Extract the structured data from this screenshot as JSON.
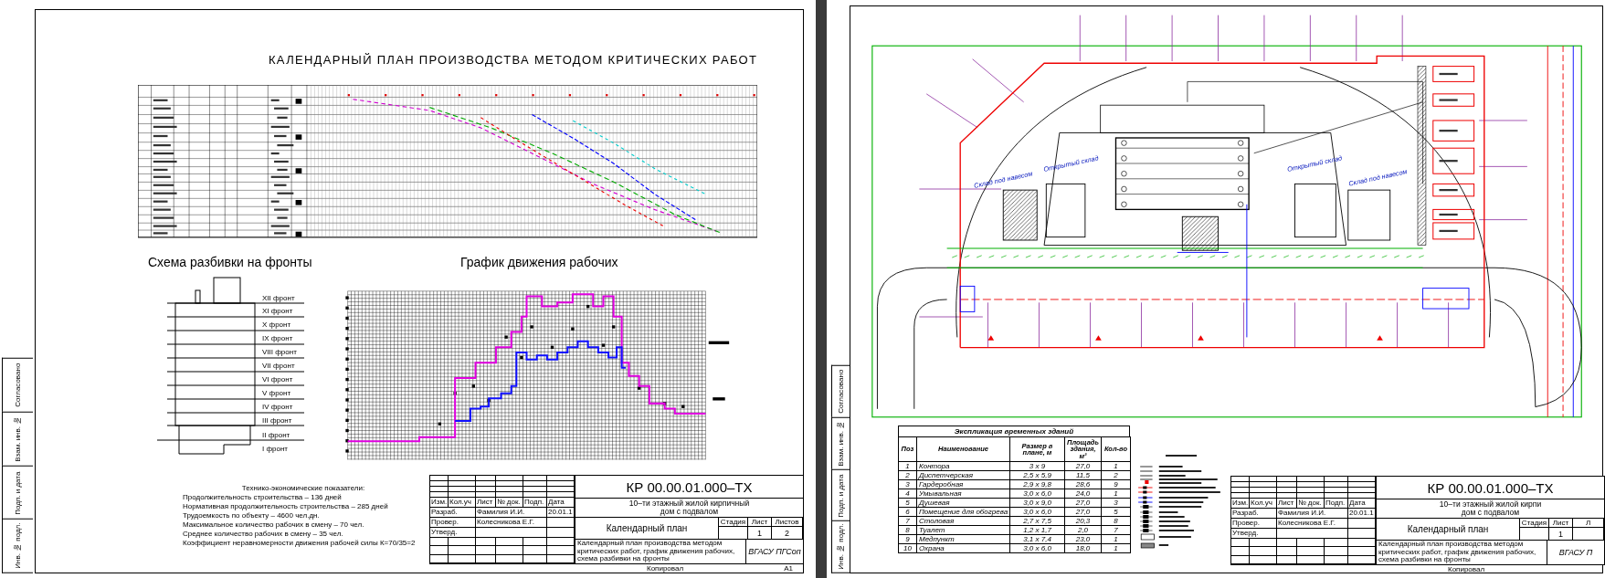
{
  "calendar_sheet": {
    "title": "КАЛЕНДАРНЫЙ ПЛАН ПРОИЗВОДСТВА МЕТОДОМ КРИТИЧЕСКИХ РАБОТ",
    "fronts_scheme": {
      "title": "Схема разбивки на фронты",
      "fronts": [
        "XII фронт",
        "XI фронт",
        "X фронт",
        "IX фронт",
        "VIII фронт",
        "VII фронт",
        "VI фронт",
        "V фронт",
        "IV фронт",
        "III фронт",
        "II фронт",
        "I фронт"
      ]
    },
    "worker_chart": {
      "title": "График движения рабочих"
    },
    "indicators": {
      "heading": "Технико-экономические показатели:",
      "lines": [
        "Продолжительность строительства – 136 дней",
        "Нормативная продолжительность строительства – 285 дней",
        "Трудоемкость по объекту – 4600 чел.дн.",
        "Максимальное количество рабочих в смену – 70 чел.",
        "Среднее количество рабочих в смену – 35 чел.",
        "Коэффициент неравномерности движения рабочей силы К=70/35=2"
      ]
    },
    "title_block": {
      "code": "КР 00.00.01.000–ТХ",
      "project": [
        "10–ти этажный жилой кирпичный",
        "дом с подвалом"
      ],
      "header": [
        "Изм.",
        "Кол.уч",
        "Лист",
        "№ док.",
        "Подп.",
        "Дата"
      ],
      "staff": [
        {
          "role": "Разраб.",
          "name": "Фамилия И.И.",
          "date": "20.01.1"
        },
        {
          "role": "Провер.",
          "name": "Колесникова Е.Г."
        },
        {
          "role": "Утверд."
        }
      ],
      "sheet_title": "Календарный план",
      "stage": [
        {
          "header": "Стадия"
        },
        {
          "header": "Лист",
          "value": "1"
        },
        {
          "header": "Листов",
          "value": "2"
        }
      ],
      "description": [
        "Календарный план производства методом",
        "критических работ, график движения рабочих,",
        "схема разбивки на фронты"
      ],
      "organization": "ВГАСУ ПГСоп",
      "copied": "Копировал",
      "format": "А1"
    },
    "margin_labels": [
      "Согласовано",
      "Взам. инв. №",
      "Подп. и дата",
      "Инв. № подл."
    ]
  },
  "site_plan_sheet": {
    "site_plan": {
      "labels": [
        "Склад под навесом",
        "Открытый склад",
        "Открытый склад",
        "Склад под навесом"
      ]
    },
    "buildings_table": {
      "title": "Экспликация временных зданий",
      "columns": [
        "Поз",
        "Наименование",
        "Размер в плане, м",
        "Площадь здания, м²",
        "Кол-во"
      ],
      "rows": [
        [
          "1",
          "Контора",
          "3 x 9",
          "27,0",
          "1"
        ],
        [
          "2",
          "Диспетчерская",
          "2,5 x 5,9",
          "11,5",
          "2"
        ],
        [
          "3",
          "Гардеробная",
          "2,9 x 9,8",
          "28,6",
          "9"
        ],
        [
          "4",
          "Умывальная",
          "3,0 x 6,0",
          "24,0",
          "1"
        ],
        [
          "5",
          "Душевая",
          "3,0 x 9,0",
          "27,0",
          "3"
        ],
        [
          "6",
          "Помещение для обогрева",
          "3,0 x 6,0",
          "27,0",
          "5"
        ],
        [
          "7",
          "Столовая",
          "2,7 x 7,5",
          "20,3",
          "8"
        ],
        [
          "8",
          "Туалет",
          "1,2 x 1,7",
          "2,0",
          "7"
        ],
        [
          "9",
          "Медпункт",
          "3,1 x 7,4",
          "23,0",
          "1"
        ],
        [
          "10",
          "Охрана",
          "3,0 x 6,0",
          "18,0",
          "1"
        ]
      ]
    },
    "title_block": {
      "code": "КР 00.00.01.000–ТХ",
      "project": [
        "10–ти этажный жилой кирпи",
        "дом с подвалом"
      ],
      "header": [
        "Изм.",
        "Кол.уч",
        "Лист",
        "№ док.",
        "Подп.",
        "Дата"
      ],
      "staff": [
        {
          "role": "Разраб.",
          "name": "Фамилия И.И.",
          "date": "20.01.1"
        },
        {
          "role": "Провер.",
          "name": "Колесникова Е.Г."
        },
        {
          "role": "Утверд."
        }
      ],
      "sheet_title": "Календарный план",
      "stage": [
        {
          "header": "Стадия"
        },
        {
          "header": "Лист",
          "value": "1"
        },
        {
          "header": "Л"
        }
      ],
      "description": [
        "Календарный план производства методом",
        "критических работ, график движения рабочих,",
        "схема разбивки на фронты"
      ],
      "organization": "ВГАСУ П",
      "copied": "Копировал"
    },
    "margin_labels": [
      "Согласовано",
      "Взам. инв. №",
      "Подп. и дата",
      "Инв. № подл."
    ]
  }
}
